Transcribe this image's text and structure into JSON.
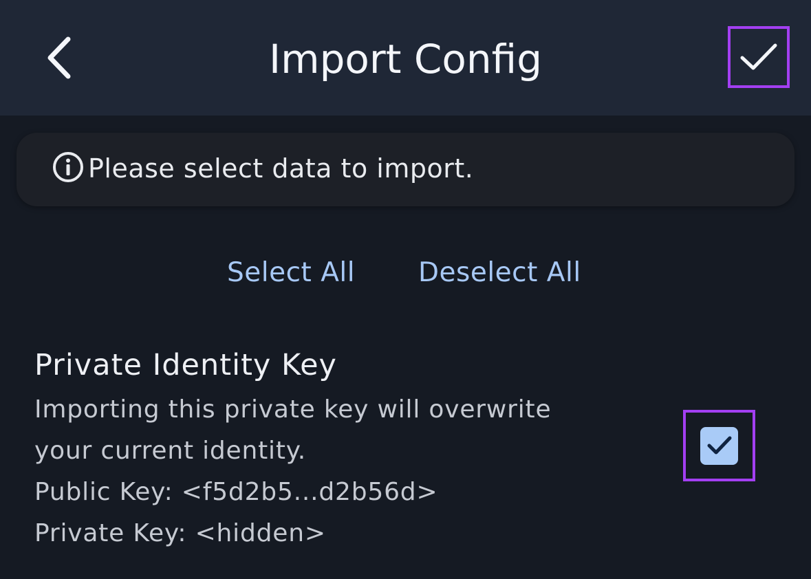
{
  "header": {
    "title": "Import Config",
    "back_icon": "chevron-left-icon",
    "confirm_icon": "check-icon"
  },
  "banner": {
    "icon": "info-icon",
    "text": "Please select data to import."
  },
  "actions": {
    "select_all": "Select All",
    "deselect_all": "Deselect All"
  },
  "items": [
    {
      "title": "Private Identity Key",
      "description_line1": "Importing this private key will overwrite",
      "description_line2": "your current identity.",
      "public_key": "Public Key: <f5d2b5...d2b56d>",
      "private_key": "Private Key: <hidden>",
      "checked": true
    }
  ],
  "colors": {
    "header_bg": "#1f2736",
    "page_bg": "#151a23",
    "accent_link": "#a7c8f5",
    "highlight_border": "#a33ff2",
    "checkbox_fill": "#a9cbf7"
  }
}
